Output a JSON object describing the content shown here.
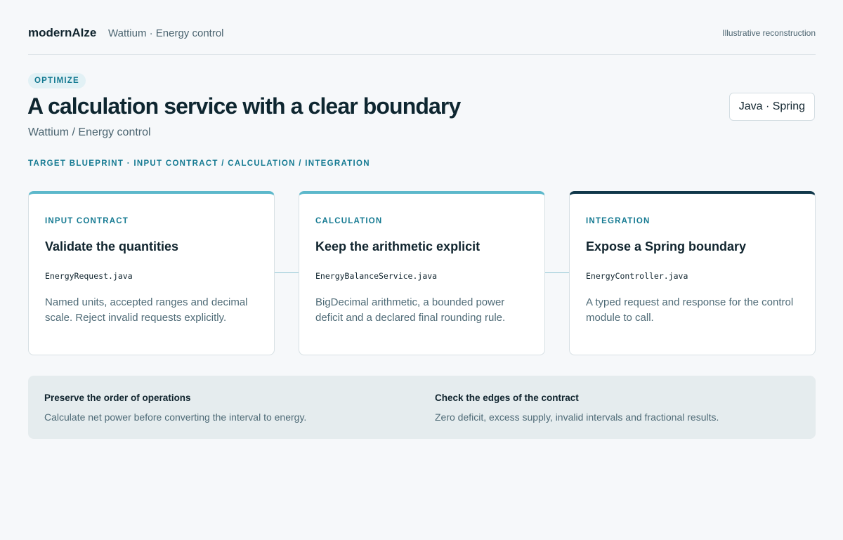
{
  "header": {
    "brand": "modernAIze",
    "context": "Wattium · Energy control",
    "note": "Illustrative reconstruction"
  },
  "hero": {
    "badge": "OPTIMIZE",
    "title": "A calculation service with a clear boundary",
    "subtitle": "Wattium / Energy control",
    "tech_label": "Java · Spring",
    "breadcrumb": "TARGET BLUEPRINT · INPUT CONTRACT / CALCULATION / INTEGRATION"
  },
  "cards": [
    {
      "eyebrow": "INPUT CONTRACT",
      "title": "Validate the quantities",
      "file": "EnergyRequest.java",
      "description": "Named units, accepted ranges and decimal scale. Reject invalid requests explicitly."
    },
    {
      "eyebrow": "CALCULATION",
      "title": "Keep the arithmetic explicit",
      "file": "EnergyBalanceService.java",
      "description": "BigDecimal arithmetic, a bounded power deficit and a declared final rounding rule."
    },
    {
      "eyebrow": "INTEGRATION",
      "title": "Expose a Spring boundary",
      "file": "EnergyController.java",
      "description": "A typed request and response for the control module to call."
    }
  ],
  "notes": [
    {
      "title": "Preserve the order of operations",
      "description": "Calculate net power before converting the interval to energy."
    },
    {
      "title": "Check the edges of the contract",
      "description": "Zero deficit, excess supply, invalid intervals and fractional results."
    }
  ],
  "colors": {
    "accent": "#157a92",
    "accent_light": "#5cb8cb",
    "accent_dark": "#10374a",
    "background": "#f6f8fa"
  }
}
